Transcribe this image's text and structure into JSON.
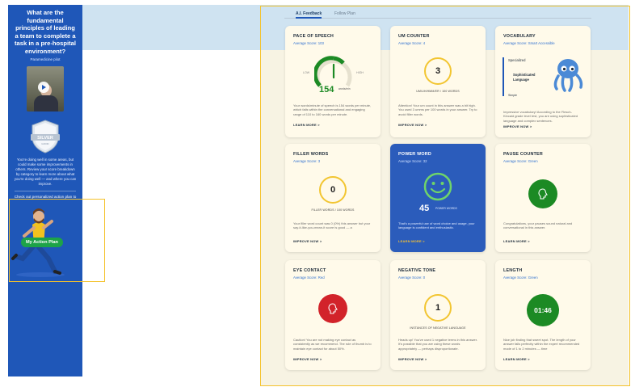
{
  "sidebar": {
    "question": "What are the fundamental principles of leading a team to complete a task in a pre-hospital environment?",
    "subtitle": "Paramedicine pilot",
    "badge_label": "SILVER",
    "badge_sub": "GOOD",
    "summary": "You're doing well in some areas, but could make some improvements in others. Review your score breakdown by category to learn more about what you're doing well — and where you can improve.",
    "cta": "Check out personalized action plan to help you improve.",
    "action_plan_label": "My Action Plan"
  },
  "tabs": [
    "A.I. Feedback",
    "Follow Plan"
  ],
  "cards": {
    "pace": {
      "title": "PACE OF SPEECH",
      "sub": "Average Score: 103",
      "low": "LOW",
      "high": "HIGH",
      "value": "154",
      "unit": "words/min",
      "desc": "Your words/minute of speech is 154 words per minute, which falls within the conversational and engaging range of 110 to 160 words per minute.",
      "link": "LEARN MORE >"
    },
    "um": {
      "title": "UM COUNTER",
      "sub": "Average Score: 4",
      "value": "3",
      "caption": "UM/UH/HMM/ER / 100 WORDS",
      "desc": "Attention! Your um count in this answer was a bit high. You used 3 umms per 100 words in your answer. Try to avoid filler words.",
      "link": "IMPROVE NOW >"
    },
    "vocab": {
      "title": "VOCABULARY",
      "sub": "Average Score: Smart Accessible",
      "level_top": "Specialized",
      "level_mid": "Sophisticated Language",
      "level_bottom": "Simple",
      "desc": "Impressive vocabulary! According to the Flesch-Kincaid grade level test, you are using sophisticated language and complex sentences.",
      "link": "IMPROVE NOW >"
    },
    "filler": {
      "title": "FILLER WORDS",
      "sub": "Average Score: 3",
      "value": "0",
      "caption": "FILLER WORDS / 100 WORDS",
      "desc": "Your filler word count was 0 (0%) this answer but your say-it-like-you-mean-it score is good — a",
      "link": "IMPROVE NOW >"
    },
    "power": {
      "title": "POWER WORD",
      "sub": "Average Score: 32",
      "value": "45",
      "unit": "POWER WORDS",
      "desc": "That's a powerful use of word choice and usage, your language is confident and enthusiastic.",
      "link": "LEARN MORE >"
    },
    "pause": {
      "title": "PAUSE COUNTER",
      "sub": "Average Score: Green",
      "desc": "Congratulations, your pauses sound natural and conversational in this answer.",
      "link": "LEARN MORE >"
    },
    "eye": {
      "title": "EYE CONTACT",
      "sub": "Average Score: Red",
      "desc": "Caution! You are not making eye contact as consistently as we recommend. The rule of thumb is to maintain eye contact for about 50%.",
      "link": "IMPROVE NOW >"
    },
    "negative": {
      "title": "NEGATIVE TONE",
      "sub": "Average Score: 0",
      "value": "1",
      "caption": "INSTANCES OF NEGATIVE LANGUAGE",
      "desc": "Heads up! You've used 1 negative terms in this answer. It's possible that you are using these words appropriately — perhaps disproportionate.",
      "link": "IMPROVE NOW >"
    },
    "length": {
      "title": "LENGTH",
      "sub": "Average Score: Green",
      "value": "01:46",
      "desc": "Nice job finding that sweet spot. The length of your answer falls perfectly within the expert recommended mode of 1 to 2 minutes — time",
      "link": "LEARN MORE >"
    }
  },
  "colors": {
    "sidebar": "#1f57b8",
    "accent_yellow": "#f2c531",
    "success_green": "#1c8a24",
    "danger_red": "#d2232a",
    "power_blue": "#2b5cbb"
  }
}
